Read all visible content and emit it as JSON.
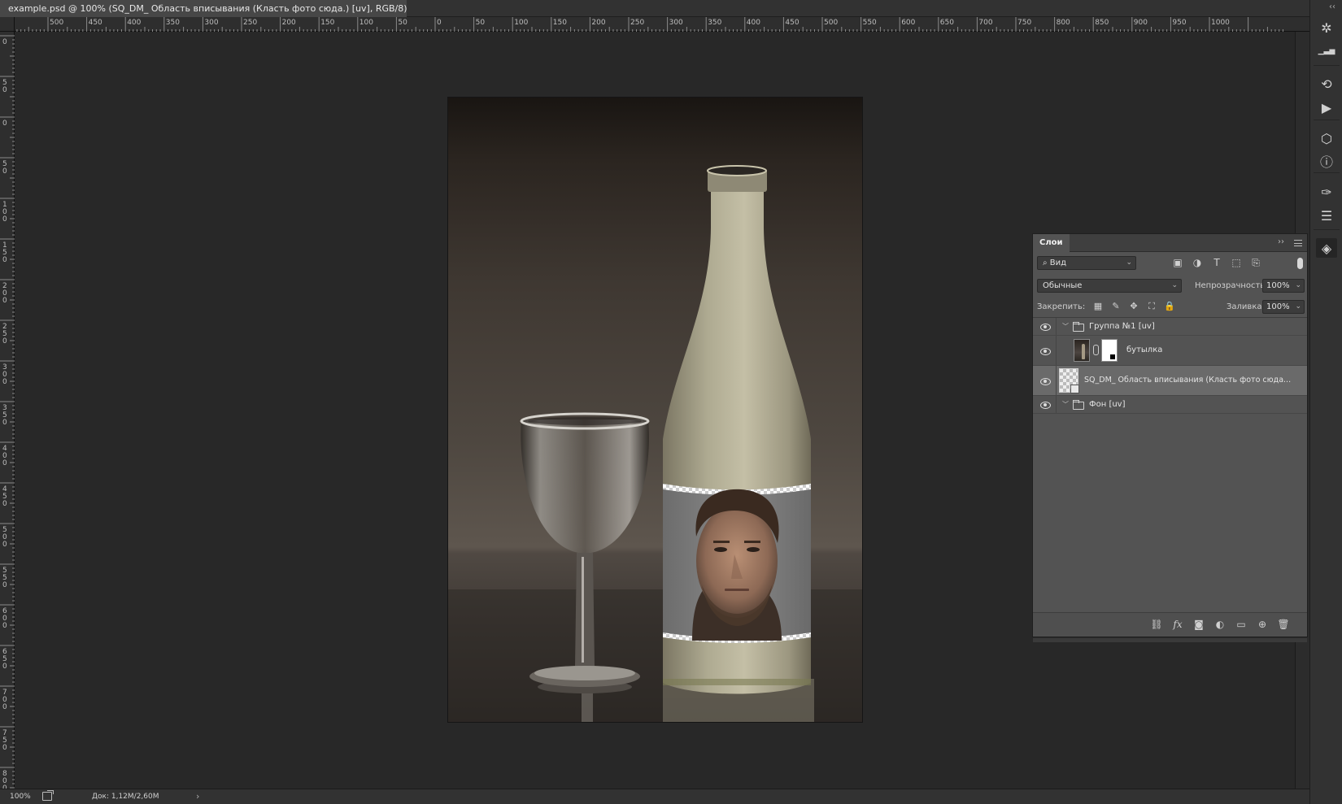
{
  "document_tab": {
    "title": "example.psd @ 100% (SQ_DM_ Область вписывания (Класть фото сюда.) [uv], RGB/8) *",
    "close_glyph": "×"
  },
  "window_collapse": "‹‹",
  "ruler_top": {
    "labels": [
      "500",
      "450",
      "400",
      "350",
      "300",
      "250",
      "200",
      "150",
      "100",
      "50",
      "0",
      "50",
      "100",
      "150",
      "200",
      "250",
      "300",
      "350",
      "400",
      "450",
      "500",
      "550",
      "600",
      "650",
      "700",
      "750",
      "800",
      "850",
      "900",
      "950",
      "1000"
    ]
  },
  "ruler_left": {
    "labels": [
      "0",
      "5\n0",
      "0",
      "5\n0",
      "1\n0\n0",
      "1\n5\n0",
      "2\n0\n0",
      "2\n5\n0",
      "3\n0\n0",
      "3\n5\n0",
      "4\n0\n0",
      "4\n5\n0",
      "5\n0\n0",
      "5\n5\n0",
      "6\n0\n0",
      "6\n5\n0",
      "7\n0\n0",
      "7\n5\n0",
      "8\n0\n0"
    ]
  },
  "status": {
    "zoom": "100%",
    "doc_size": "Док: 1,12M/2,60M",
    "arrow": "›"
  },
  "layers_panel": {
    "tab_label": "Слои",
    "collapse_glyph": "››",
    "filter": {
      "label": "⌕ Вид",
      "dropdown": "⌄",
      "icons": [
        "image-filter-icon",
        "adjustment-filter-icon",
        "type-filter-icon",
        "shape-filter-icon",
        "smart-object-filter-icon"
      ],
      "icon_glyphs": [
        "▣",
        "◑",
        "T",
        "⬚",
        "⎘"
      ]
    },
    "blend": {
      "mode": "Обычные",
      "dropdown": "⌄",
      "opacity_label": "Непрозрачность:",
      "opacity_value": "100%"
    },
    "lock": {
      "label": "Закрепить:",
      "icon_glyphs": [
        "▦",
        "✎",
        "✥",
        "⛶",
        "🔒"
      ],
      "icons": [
        "lock-transparent-icon",
        "lock-pixels-icon",
        "lock-position-icon",
        "lock-artboard-icon",
        "lock-all-icon"
      ],
      "fill_label": "Заливка:",
      "fill_value": "100%"
    },
    "layers": [
      {
        "name": "Группа №1 [uv]",
        "type": "group",
        "expanded": true,
        "selected": false
      },
      {
        "name": "бутылка",
        "type": "masked",
        "selected": false
      },
      {
        "name": "SQ_DM_ Область вписывания (Класть фото сюда...",
        "type": "smart",
        "selected": true
      },
      {
        "name": "Фон [uv]",
        "type": "group",
        "expanded": true,
        "selected": false
      }
    ],
    "footer_icons": [
      "link-layers-icon",
      "fx-icon",
      "add-mask-icon",
      "new-fill-adjustment-icon",
      "new-group-icon",
      "new-layer-icon",
      "delete-layer-icon"
    ],
    "footer_glyphs": [
      "⛓",
      "fx",
      "◙",
      "◐",
      "▭",
      "⊕",
      "🗑"
    ]
  },
  "right_strip": {
    "icons": [
      "color-navigator-icon",
      "histogram-icon",
      "history-icon",
      "actions-play-icon",
      "3d-icon",
      "info-icon",
      "brush-tool-icon",
      "properties-icon",
      "layers-icon"
    ],
    "glyphs": [
      "✲",
      "▁▃▅",
      "⟲",
      "▶",
      "⬡",
      "ⓘ",
      "✑",
      "☰",
      "◈"
    ]
  }
}
